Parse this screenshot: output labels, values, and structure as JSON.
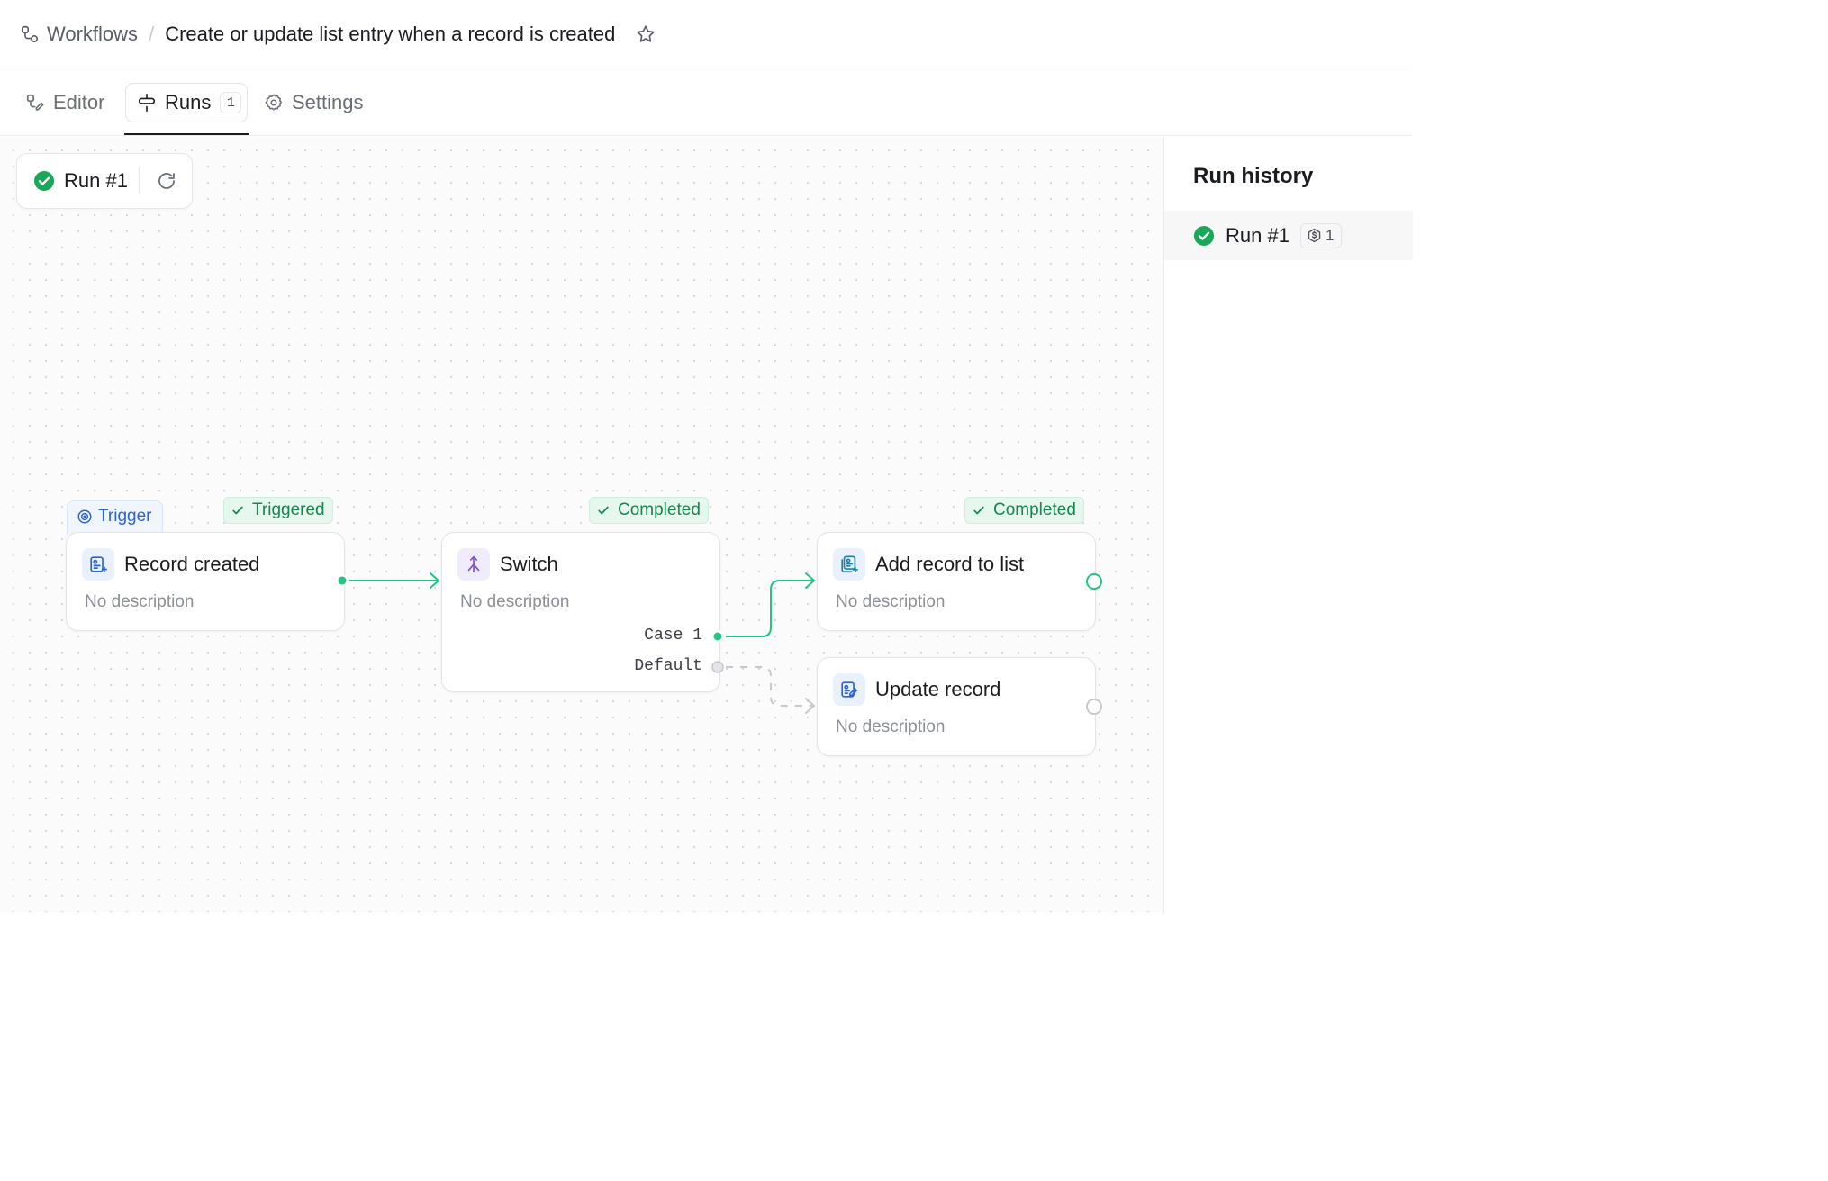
{
  "breadcrumb": {
    "root": "Workflows",
    "title": "Create or update list entry when a record is created"
  },
  "tabs": [
    {
      "label": "Editor"
    },
    {
      "label": "Runs",
      "count": "1",
      "active": true
    },
    {
      "label": "Settings"
    }
  ],
  "canvas": {
    "current_run": "Run #1",
    "nodes": {
      "trigger": {
        "tag": "Trigger",
        "status": "Triggered",
        "title": "Record created",
        "description": "No description"
      },
      "switch": {
        "status": "Completed",
        "title": "Switch",
        "description": "No description",
        "cases": [
          "Case 1",
          "Default"
        ]
      },
      "add_to_list": {
        "status": "Completed",
        "title": "Add record to list",
        "description": "No description"
      },
      "update_record": {
        "title": "Update record",
        "description": "No description"
      }
    }
  },
  "run_history": {
    "title": "Run history",
    "items": [
      {
        "label": "Run #1",
        "credits": "1"
      }
    ]
  },
  "colors": {
    "success": "#19a75a",
    "edge_active": "#1fc782",
    "edge_inactive": "#c6c8cd",
    "accent_blue": "#2a63d6",
    "switch_purple": "#7c4ddb"
  }
}
